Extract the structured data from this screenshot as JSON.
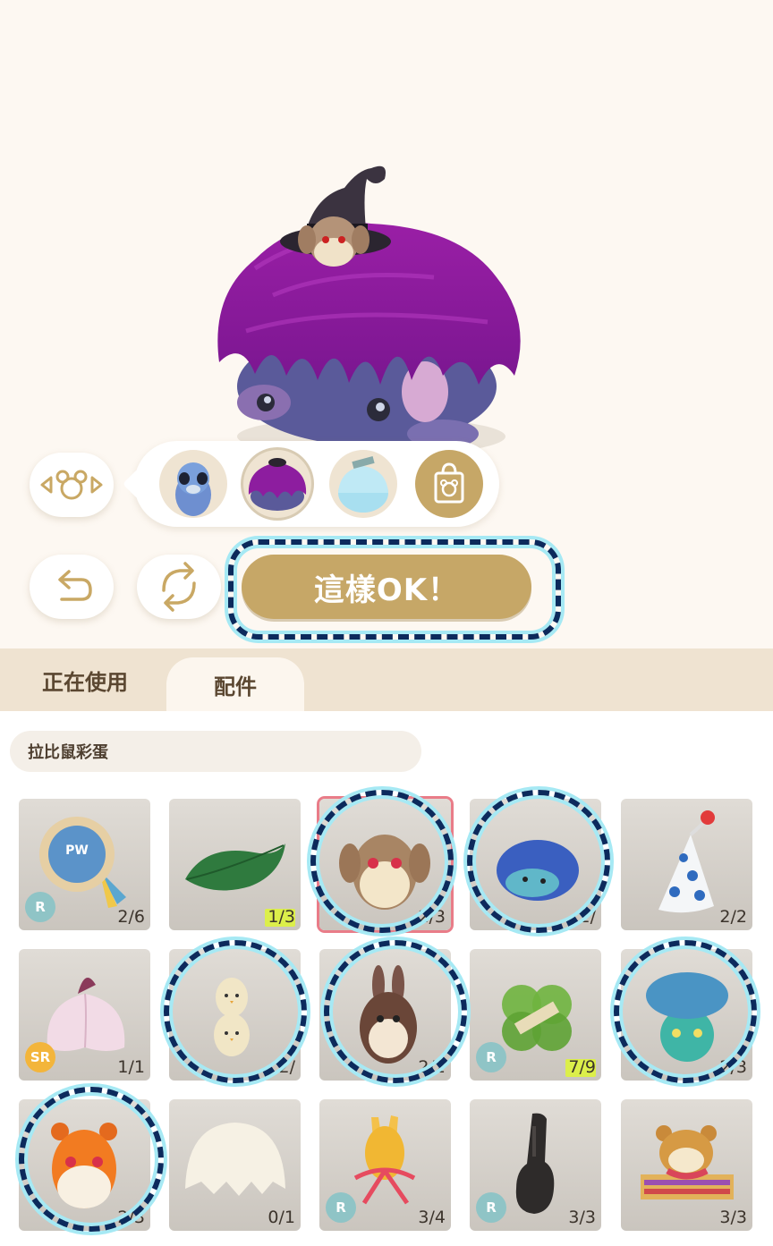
{
  "actions": {
    "confirm_label": "這樣OK！"
  },
  "tabs": [
    {
      "label": "正在使用",
      "active": false
    },
    {
      "label": "配件",
      "active": true
    }
  ],
  "filter": {
    "label": "拉比鼠彩蛋"
  },
  "items": [
    {
      "name": "badge",
      "count": "2/6",
      "rarity": "R"
    },
    {
      "name": "leaf",
      "count": "1/3",
      "rarity": ""
    },
    {
      "name": "monkey-egg",
      "count": "2/3",
      "rarity": ""
    },
    {
      "name": "blue-hedgehog",
      "count": "2/",
      "rarity": ""
    },
    {
      "name": "party-hat",
      "count": "2/2",
      "rarity": ""
    },
    {
      "name": "flower",
      "count": "1/1",
      "rarity": "SR"
    },
    {
      "name": "chick-stack",
      "count": "2/",
      "rarity": ""
    },
    {
      "name": "bunny-egg",
      "count": "2/2",
      "rarity": ""
    },
    {
      "name": "clover",
      "count": "7/9",
      "rarity": "R"
    },
    {
      "name": "mushroom",
      "count": "2/3",
      "rarity": ""
    },
    {
      "name": "hamster-egg",
      "count": "2/3",
      "rarity": ""
    },
    {
      "name": "eggshell",
      "count": "0/1",
      "rarity": ""
    },
    {
      "name": "ribbon",
      "count": "3/4",
      "rarity": "R"
    },
    {
      "name": "guitar-case",
      "count": "3/3",
      "rarity": "R"
    },
    {
      "name": "hamster-scarf",
      "count": "3/3",
      "rarity": ""
    }
  ],
  "colors": {
    "accent": "#c6a767",
    "background": "#fdf8f2",
    "tab_bar": "#efe3d1",
    "annotation_dash": "#0c2a5c",
    "annotation_glow": "#a6e9f4",
    "selection": "#e97c88"
  },
  "icons": [
    "mouse-face-arrows-icon",
    "undo-icon",
    "refresh-icon",
    "shop-bag-icon"
  ]
}
